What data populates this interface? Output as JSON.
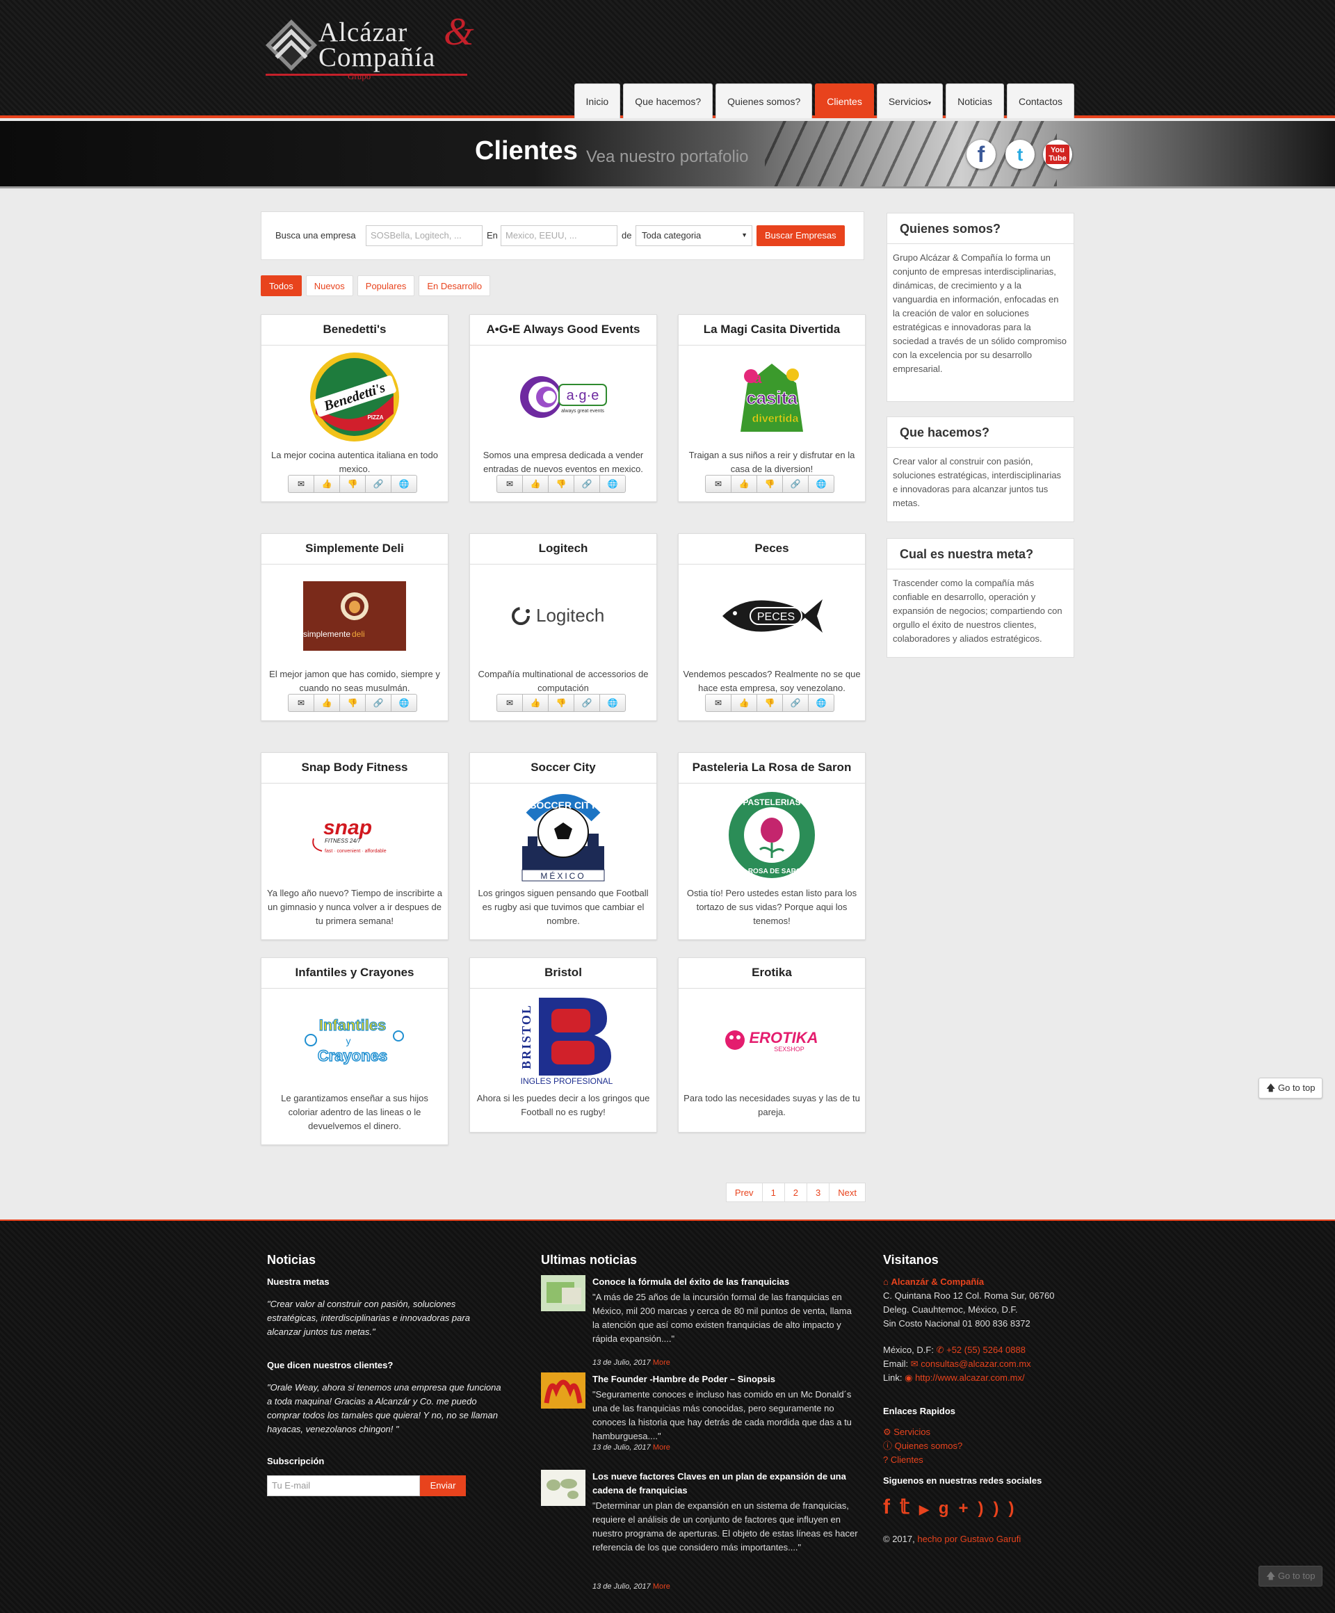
{
  "logo": {
    "line1": "Alcázar",
    "amp": "&",
    "line2": "Compañía",
    "sub": "Grupo"
  },
  "nav": [
    {
      "label": "Inicio"
    },
    {
      "label": "Que hacemos?"
    },
    {
      "label": "Quienes somos?"
    },
    {
      "label": "Clientes"
    },
    {
      "label": "Servicios"
    },
    {
      "label": "Noticias"
    },
    {
      "label": "Contactos"
    }
  ],
  "banner": {
    "title": "Clientes",
    "subtitle": "Vea nuestro portafolio",
    "facebook": "f",
    "twitter": "t",
    "youtube_top": "You",
    "youtube_bottom": "Tube"
  },
  "search": {
    "label_company": "Busca una empresa",
    "company_placeholder": "SOSBella, Logitech, ...",
    "label_in": "En",
    "location_placeholder": "Mexico, EEUU, ...",
    "label_of": "de",
    "category_value": "Toda categoria",
    "button": "Buscar Empresas"
  },
  "filters": [
    "Todos",
    "Nuevos",
    "Populares",
    "En Desarrollo"
  ],
  "cards": [
    {
      "title": "Benedetti's",
      "desc": "La mejor cocina autentica italiana en todo mexico.",
      "logo": "benedettis-logo"
    },
    {
      "title": "A•G•E Always Good Events",
      "desc": "Somos una empresa dedicada a vender entradas de nuevos eventos en mexico.",
      "logo": "age-logo"
    },
    {
      "title": "La Magi Casita Divertida",
      "desc": "Traigan a sus niños a reir y disfrutar en la casa de la diversion!",
      "logo": "casita-logo"
    },
    {
      "title": "Simplemente Deli",
      "desc": "El mejor jamon que has comido, siempre y cuando no seas musulmán.",
      "logo": "deli-logo"
    },
    {
      "title": "Logitech",
      "desc": "Compañía multinational de accessorios de computación",
      "logo": "logitech-logo"
    },
    {
      "title": "Peces",
      "desc": "Vendemos pescados? Realmente no se que hace esta empresa, soy venezolano.",
      "logo": "peces-logo"
    },
    {
      "title": "Snap Body Fitness",
      "desc": "Ya llego año nuevo? Tiempo de inscribirte a un gimnasio y nunca volver a ir despues de tu primera semana!",
      "logo": "snap-logo"
    },
    {
      "title": "Soccer City",
      "desc": "Los gringos siguen pensando que Football es rugby asi que tuvimos que cambiar el nombre.",
      "logo": "soccer-logo"
    },
    {
      "title": "Pasteleria La Rosa de Saron",
      "desc": "Ostia tío! Pero ustedes estan listo para los tortazo de sus vidas? Porque aqui los tenemos!",
      "logo": "rosa-logo"
    },
    {
      "title": "Infantiles y Crayones",
      "desc": "Le garantizamos enseñar a sus hijos coloriar adentro de las lineas o le devuelvemos el dinero.",
      "logo": "crayones-logo"
    },
    {
      "title": "Bristol",
      "desc": "Ahora si les puedes decir a los gringos que Football no es rugby!",
      "logo": "bristol-logo"
    },
    {
      "title": "Erotika",
      "desc": "Para todo las necesidades suyas y las de tu pareja.",
      "logo": "erotika-logo"
    }
  ],
  "logo_text": {
    "benedettis": "Benedetti's",
    "benedettis_sub": "PIZZA",
    "age": "a·g·e",
    "age_sub": "always great events",
    "casita_1": "la",
    "casita_2": "casita",
    "casita_3": "divertida",
    "deli_1": "simplemente",
    "deli_2": "deli",
    "logitech": "Logitech",
    "peces": "PECES",
    "snap": "snap",
    "snap_sub1": "FITNESS 24/7",
    "snap_sub2": "fast · convenient · affordable",
    "soccer_1": "SOCCER CITY",
    "soccer_2": "MÉXICO",
    "rosa_1": "PASTELERIAS",
    "rosa_2": "LA ROSA DE SARON",
    "crayones_1": "Infantiles",
    "crayones_2": "y",
    "crayones_3": "Crayones",
    "bristol_1": "BRISTOL",
    "bristol_2": "INGLES PROFESIONAL",
    "erotika_1": "EROTIKA",
    "erotika_2": "SEXSHOP"
  },
  "sidebar": [
    {
      "title": "Quienes somos?",
      "text": "Grupo Alcázar & Compañía lo forma un conjunto de empresas interdisciplinarias, dinámicas, de crecimiento y a la vanguardia en información, enfocadas en la creación de valor en soluciones estratégicas e innovadoras para la sociedad a través de un sólido compromiso con la excelencia por su desarrollo empresarial."
    },
    {
      "title": "Que hacemos?",
      "text": "Crear valor al construir con pasión, soluciones estratégicas, interdisciplinarias e innovadoras para alcanzar juntos tus metas."
    },
    {
      "title": "Cual es nuestra meta?",
      "text": "Trascender como la compañía más confiable en desarrollo, operación y expansión de negocios; compartiendo con orgullo el éxito de nuestros clientes, colaboradores y aliados estratégicos."
    }
  ],
  "pagination": [
    "Prev",
    "1",
    "2",
    "3",
    "Next"
  ],
  "go_top": "Go to top",
  "footer": {
    "noticias_title": "Noticias",
    "metas_title": "Nuestra metas",
    "metas_quote": "\"Crear valor al construir con pasión, soluciones estratégicas, interdisciplinarias e innovadoras para alcanzar juntos tus metas.\"",
    "clientes_title": "Que dicen nuestros clientes?",
    "clientes_quote": "\"Orale Weay, ahora si tenemos una empresa que funciona a toda maquina! Gracias a Alcanzár y Co. me puedo comprar todos los tamales que quiera! Y no, no se llaman hayacas, venezolanos chingon! \"",
    "subs_title": "Subscripción",
    "email_placeholder": "Tu E-mail",
    "send": "Enviar",
    "ultimas_title": "Ultimas noticias",
    "news": [
      {
        "title": "Conoce la fórmula del éxito de las franquicias",
        "text": "\"A más de 25 años de la incursión formal de las franquicias en México, mil 200 marcas y cerca de 80 mil puntos de venta, llama la atención que así como existen franquicias de alto impacto y rápida expansión....\"",
        "date": "13 de Julio, 2017",
        "more": "More"
      },
      {
        "title": "The Founder -Hambre de Poder – Sinopsis",
        "text": "\"Seguramente conoces e incluso has comido en un Mc Donald´s una de las franquicias más conocidas, pero seguramente no conoces la historia que hay detrás de cada mordida que das a tu hamburguesa....\"",
        "date": "13 de Julio, 2017",
        "more": "More"
      },
      {
        "title": "Los nueve factores Claves en un plan de expansión de una cadena de franquicias",
        "text": "\"Determinar un plan de expansión en un sistema de franquicias, requiere el análisis de un conjunto de factores que influyen en nuestro programa de aperturas. El objeto de estas líneas es hacer referencia de los que considero más importantes....\"",
        "date": "13 de Julio, 2017",
        "more": "More"
      }
    ],
    "visitanos_title": "Visitanos",
    "company": "Alcanzár & Compañía",
    "address1": "C. Quintana Roo 12 Col. Roma Sur, 06760",
    "address2": "Deleg. Cuauhtemoc, México, D.F.",
    "address3": "Sin Costo Nacional 01 800 836 8372",
    "phone_label": "México, D.F:",
    "phone": "+52 (55) 5264 0888",
    "email_label": "Email:",
    "email": "consultas@alcazar.com.mx",
    "link_label": "Link:",
    "link": "http://www.alcazar.com.mx/",
    "enlaces_title": "Enlaces Rapidos",
    "enlaces": [
      "Servicios",
      "Quienes somos?",
      "Clientes"
    ],
    "redes_title": "Siguenos en nuestras redes sociales",
    "copyright": "© 2017,",
    "credit": "hecho por Gustavo Garufi"
  },
  "colors": {
    "accent": "#e8431d",
    "brand_red": "#c4202a"
  }
}
